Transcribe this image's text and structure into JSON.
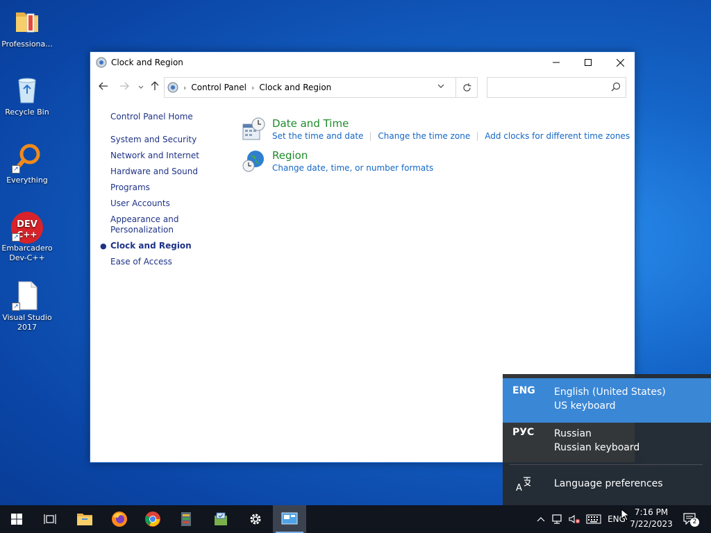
{
  "desktop": {
    "icons": [
      {
        "label": "Professiona..."
      },
      {
        "label": "Recycle Bin"
      },
      {
        "label": "Everything"
      },
      {
        "label": "Embarcadero Dev-C++"
      },
      {
        "label": "Visual Studio 2017"
      }
    ]
  },
  "window": {
    "title": "Clock and Region",
    "address": {
      "root": "Control Panel",
      "current": "Clock and Region"
    },
    "search_placeholder": ""
  },
  "nav_pane": {
    "home": "Control Panel Home",
    "items": [
      "System and Security",
      "Network and Internet",
      "Hardware and Sound",
      "Programs",
      "User Accounts",
      "Appearance and Personalization",
      "Clock and Region",
      "Ease of Access"
    ],
    "active_index": 6
  },
  "categories": [
    {
      "title": "Date and Time",
      "links": [
        "Set the time and date",
        "Change the time zone",
        "Add clocks for different time zones"
      ]
    },
    {
      "title": "Region",
      "links": [
        "Change date, time, or number formats"
      ]
    }
  ],
  "language_flyout": {
    "languages": [
      {
        "code": "ENG",
        "name": "English (United States)",
        "keyboard": "US keyboard",
        "selected": true
      },
      {
        "code": "РУС",
        "name": "Russian",
        "keyboard": "Russian keyboard",
        "selected": false
      }
    ],
    "preferences": "Language preferences"
  },
  "taskbar": {
    "lang_indicator": "ENG",
    "time": "7:16 PM",
    "date": "7/22/2023",
    "notification_count": "2"
  },
  "colors": {
    "link": "#1467c5",
    "category_title": "#1e8a2a",
    "nav_text": "#1e3287",
    "flyout_selected": "#3a87d6"
  }
}
